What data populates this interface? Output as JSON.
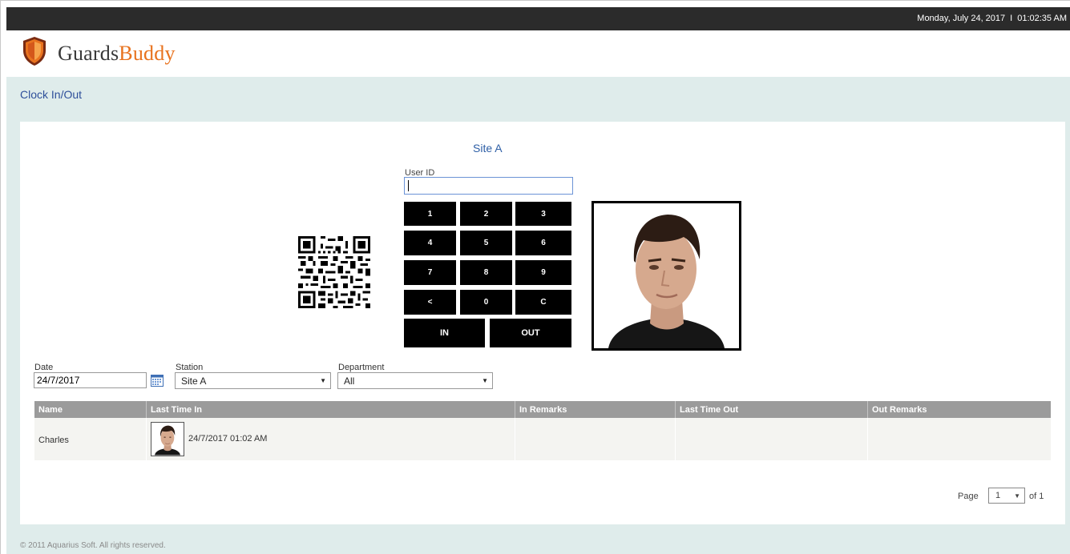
{
  "topbar": {
    "date": "Monday, July 24, 2017",
    "separator": "I",
    "time": "01:02:35 AM"
  },
  "brand": {
    "name_part1": "Guards",
    "name_part2": "Buddy",
    "accent_color": "#e8731f",
    "shield_icon": "shield-icon"
  },
  "page": {
    "section_title": "Clock In/Out"
  },
  "clock": {
    "site": "Site A",
    "user_id_label": "User ID",
    "user_id_value": "",
    "keys": [
      "1",
      "2",
      "3",
      "4",
      "5",
      "6",
      "7",
      "8",
      "9",
      "<",
      "0",
      "C"
    ],
    "in_label": "IN",
    "out_label": "OUT",
    "qr_icon": "qr-code-icon",
    "photo_icon": "user-photo"
  },
  "filters": {
    "date_label": "Date",
    "date_value": "24/7/2017",
    "calendar_icon": "calendar-icon",
    "station_label": "Station",
    "station_value": "Site A",
    "department_label": "Department",
    "department_value": "All"
  },
  "table": {
    "columns": [
      "Name",
      "Last Time In",
      "In Remarks",
      "Last Time Out",
      "Out Remarks"
    ],
    "rows": [
      {
        "name": "Charles",
        "last_time_in": "24/7/2017 01:02 AM",
        "in_remarks": "",
        "last_time_out": "",
        "out_remarks": ""
      }
    ]
  },
  "pager": {
    "page_label": "Page",
    "current": "1",
    "of_label": "of 1"
  },
  "footer": {
    "copyright": "© 2011 Aquarius Soft.   All rights reserved."
  },
  "colors": {
    "topbar": "#2b2b2b",
    "band": "#dfeceb",
    "title_blue": "#2e4f9a",
    "keypad": "#000000",
    "grid_header": "#9b9b9b"
  }
}
